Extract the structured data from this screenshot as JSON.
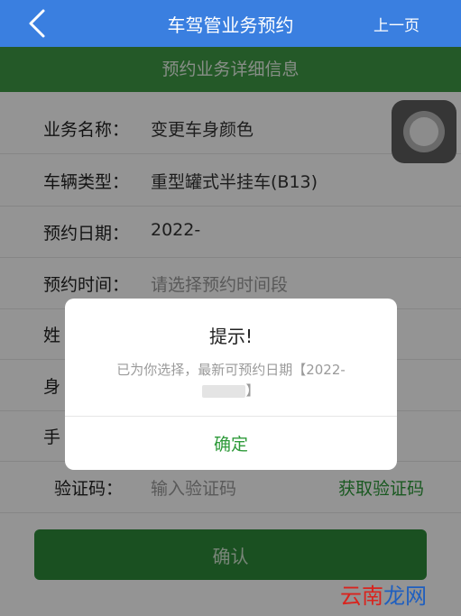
{
  "header": {
    "title": "车驾管业务预约",
    "back_icon": "chevron-left-icon",
    "prev_label": "上一页"
  },
  "section": {
    "title": "预约业务详细信息"
  },
  "form": {
    "fields": [
      {
        "label": "业务名称：",
        "value": "变更车身颜色"
      },
      {
        "label": "车辆类型：",
        "value": "重型罐式半挂车(B13)"
      },
      {
        "label": "预约日期：",
        "value": "2022-"
      },
      {
        "label": "预约时间：",
        "placeholder": "请选择预约时间段"
      },
      {
        "label": "姓",
        "value": ""
      },
      {
        "label": "身",
        "value": ""
      },
      {
        "label": "手",
        "value": ""
      },
      {
        "label": "验证码：",
        "placeholder": "输入验证码"
      }
    ],
    "get_code_label": "获取验证码",
    "confirm_label": "确认"
  },
  "dialog": {
    "title": "提示!",
    "message": "已为你选择，最新可预约日期【2022-",
    "message_end": "】",
    "ok_label": "确定"
  },
  "watermark": {
    "text_red": "云南",
    "text_blue": "龙网"
  },
  "colors": {
    "header_bg": "#3a7fe0",
    "section_bg": "#3f9a45",
    "accent_green": "#2e9a3a",
    "watermark_red": "#d9241e",
    "watermark_blue": "#1f5fbf"
  }
}
